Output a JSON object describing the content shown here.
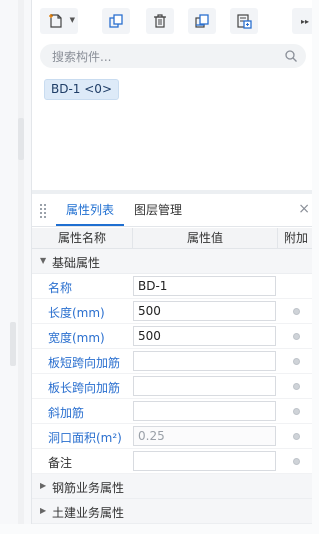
{
  "search": {
    "placeholder": "搜索构件..."
  },
  "component_tag": "BD-1 <0>",
  "tabs": [
    {
      "label": "属性列表",
      "active": true
    },
    {
      "label": "图层管理",
      "active": false
    }
  ],
  "close_glyph": "×",
  "table": {
    "headers": {
      "name": "属性名称",
      "value": "属性值",
      "extra": "附加"
    },
    "groups": {
      "basic": "基础属性",
      "rebar": "钢筋业务属性",
      "civil": "土建业务属性"
    },
    "rows": [
      {
        "name": "名称",
        "value": "BD-1",
        "name_color": "blue",
        "has_checkbox": false
      },
      {
        "name": "长度(mm)",
        "value": "500",
        "name_color": "blue",
        "has_checkbox": true
      },
      {
        "name": "宽度(mm)",
        "value": "500",
        "name_color": "blue",
        "has_checkbox": true
      },
      {
        "name": "板短跨向加筋",
        "value": "",
        "name_color": "blue",
        "has_checkbox": true
      },
      {
        "name": "板长跨向加筋",
        "value": "",
        "name_color": "blue",
        "has_checkbox": true
      },
      {
        "name": "斜加筋",
        "value": "",
        "name_color": "blue",
        "has_checkbox": true
      },
      {
        "name": "洞口面积(m²)",
        "value": "0.25",
        "name_color": "blue",
        "has_checkbox": true,
        "disabled": true
      },
      {
        "name": "备注",
        "value": "",
        "name_color": "dark",
        "has_checkbox": true
      }
    ]
  },
  "colors": {
    "accent": "#1f6fd1",
    "label_blue": "#2a6fcf",
    "tag_bg": "#ddeaf8"
  },
  "icons": [
    "new-component-icon",
    "dropdown-caret-icon",
    "copy-icon",
    "delete-icon",
    "layer-copy-icon",
    "floor-copy-icon",
    "expand-more-icon",
    "search-icon",
    "grip-icon"
  ]
}
